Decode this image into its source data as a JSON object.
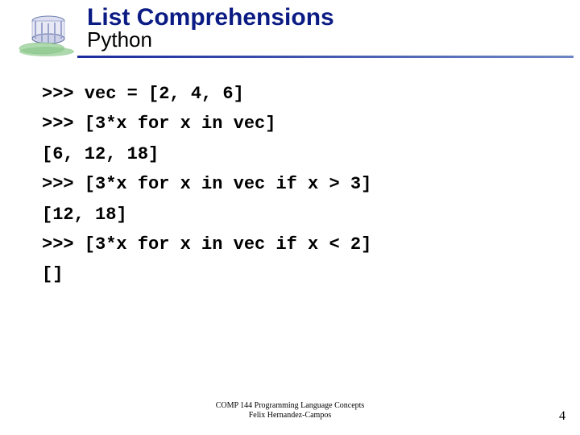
{
  "header": {
    "title": "List Comprehensions",
    "subtitle": "Python"
  },
  "code": {
    "lines": [
      ">>> vec = [2, 4, 6]",
      ">>> [3*x for x in vec]",
      "[6, 12, 18]",
      ">>> [3*x for x in vec if x > 3]",
      "[12, 18]",
      ">>> [3*x for x in vec if x < 2]",
      "[]"
    ]
  },
  "footer": {
    "line1": "COMP 144 Programming Language Concepts",
    "line2": "Felix Hernandez-Campos"
  },
  "page": "4"
}
